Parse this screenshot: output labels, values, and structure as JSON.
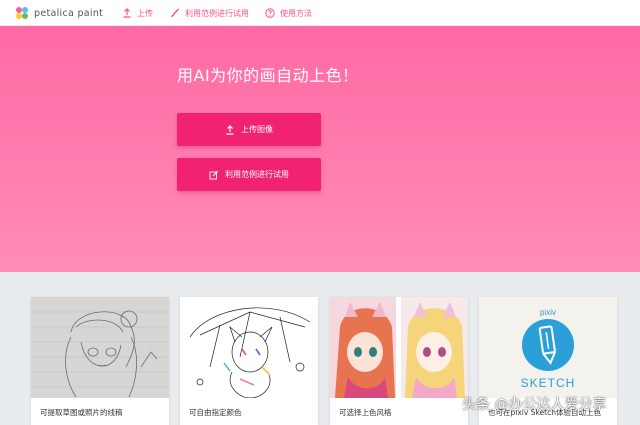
{
  "nav": {
    "logo_text": "petalica paint",
    "upload": "上传",
    "sample": "利用范例进行试用",
    "help": "使用方法"
  },
  "hero": {
    "title": "用AI为你的画自动上色！",
    "upload_button": "上传图像",
    "sample_button": "利用范例进行试用"
  },
  "cards": [
    {
      "caption": "可提取草图或照片的线稿"
    },
    {
      "caption": "可自由指定颜色"
    },
    {
      "caption": "可选择上色风格"
    },
    {
      "caption": "也可在pixiv Sketch体验自动上色",
      "badge_top": "pixiv",
      "badge_bottom": "SKETCH"
    }
  ],
  "watermark": "头条 @办公达人爱分享",
  "colors": {
    "accent": "#ff4f8b",
    "button": "#f1226f",
    "hero_top": "#ff6aa3",
    "hero_bottom": "#ff8cb8",
    "sketch_blue": "#2a9fd8"
  }
}
